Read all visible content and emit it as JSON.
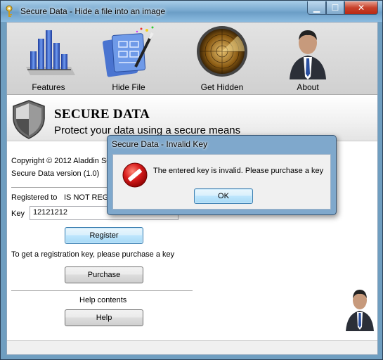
{
  "window": {
    "title": "Secure Data - Hide a file into an image",
    "min_glyph": "▁",
    "max_glyph": "☐",
    "close_glyph": "✕"
  },
  "toolbar": {
    "items": [
      {
        "label": "Features",
        "icon": "bar-chart-icon"
      },
      {
        "label": "Hide File",
        "icon": "magic-wand-image-icon"
      },
      {
        "label": "Get Hidden",
        "icon": "radar-icon"
      },
      {
        "label": "About",
        "icon": "businessman-icon"
      }
    ]
  },
  "banner": {
    "title": "SECURE DATA",
    "subtitle": "Protect your data using a secure means"
  },
  "info": {
    "copyright": "Copyright © 2012 Aladdin Sc",
    "version": "Secure Data version (1.0)"
  },
  "registration": {
    "registered_label": "Registered to",
    "registered_value": "IS NOT REGI",
    "key_label": "Key",
    "key_value": "12121212",
    "register_button": "Register",
    "purchase_hint": "To get a registration key, please purchase a key",
    "purchase_button": "Purchase"
  },
  "help": {
    "heading": "Help contents",
    "help_button": "Help"
  },
  "dialog": {
    "title": "Secure Data - Invalid Key",
    "message": "The entered key is invalid. Please purchase a key",
    "ok_button": "OK",
    "icon": "stop-error-icon"
  },
  "colors": {
    "title_bar": "#7aaad0",
    "close_button": "#c7412b",
    "focus_button": "#bee6fd",
    "error_icon": "#d81c1c"
  }
}
